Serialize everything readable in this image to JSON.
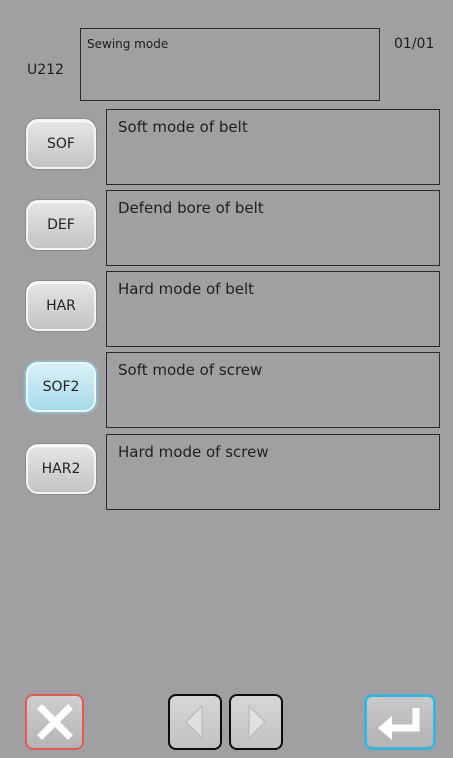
{
  "header": {
    "code": "U212",
    "title": "Sewing mode",
    "page": "01/01"
  },
  "modes": [
    {
      "label": "SOF",
      "description": "Soft mode of belt",
      "selected": false
    },
    {
      "label": "DEF",
      "description": "Defend bore of belt",
      "selected": false
    },
    {
      "label": "HAR",
      "description": "Hard mode of belt",
      "selected": false
    },
    {
      "label": "SOF2",
      "description": "Soft mode of screw",
      "selected": true
    },
    {
      "label": "HAR2",
      "description": "Hard mode of screw",
      "selected": false
    }
  ],
  "footer": {
    "cancel_icon": "close-icon",
    "prev_icon": "arrow-left-icon",
    "next_icon": "arrow-right-icon",
    "enter_icon": "enter-return-icon"
  },
  "colors": {
    "background": "#a0a0a2",
    "cancel_border": "#e05b55",
    "enter_border": "#3fb2da",
    "selected_button": "#a8dae8"
  }
}
